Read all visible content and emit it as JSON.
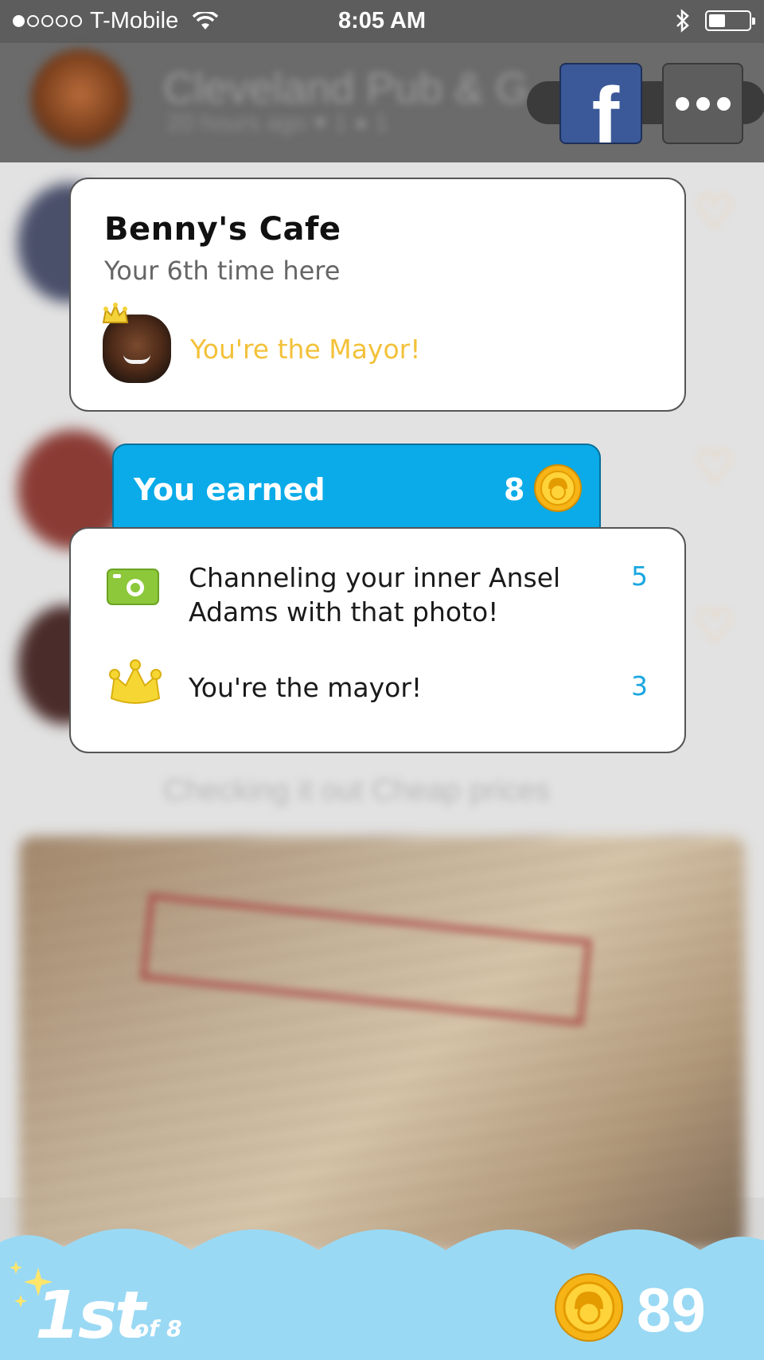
{
  "status_bar": {
    "carrier": "T-Mobile",
    "time": "8:05 AM",
    "signal_bars_filled": 1,
    "signal_bars_total": 5,
    "battery_level": 0.35
  },
  "background": {
    "venue_title": "Cleveland Pub & G",
    "venue_meta": "20 hours ago  ♥ 1  ● 1",
    "checkin_text": "Checking it out Cheap prices"
  },
  "header_actions": {
    "facebook_label": "f",
    "more_icon": "ellipsis-icon",
    "facebook_color": "#3b5998"
  },
  "venue_card": {
    "name": "Benny's Cafe",
    "visits": "Your 6th time here",
    "mayor_text": "You're the Mayor!",
    "mayor_color": "#f3c13a"
  },
  "earned": {
    "label": "You earned",
    "total": "8",
    "header_color": "#0aabe8",
    "items": [
      {
        "icon": "camera-icon",
        "description": "Channeling your inner Ansel Adams with that photo!",
        "points": "5"
      },
      {
        "icon": "crown-icon",
        "description": "You're the mayor!",
        "points": "3"
      }
    ]
  },
  "footer": {
    "rank": "1st",
    "rank_of": "of 8",
    "coins": "89",
    "bar_color": "#9ad9f4"
  }
}
